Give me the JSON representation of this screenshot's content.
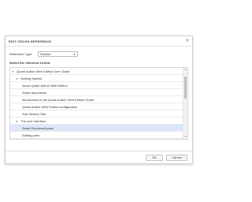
{
  "dialog": {
    "title": "EDIT CROSS REFERENCE",
    "close_icon": "×",
    "reference_type_label": "Reference Type:",
    "reference_type_value": "Section",
    "select_label": "Select the reference to link:",
    "ok_label": "OK",
    "cancel_label": "Cancel"
  },
  "tree": {
    "items": [
      {
        "label": "Quark Author Web Edition User Guide",
        "expander": "▼"
      },
      {
        "label": "Getting Started",
        "expander": "▼"
      },
      {
        "label": "About Quark Author Web Edition"
      },
      {
        "label": "Smart documents"
      },
      {
        "label": "Introduction to the Quark Author Web Edition Guide"
      },
      {
        "label": "Quark Author Web Edition configuration"
      },
      {
        "label": "Sub-Section Title"
      },
      {
        "label": "The user interface",
        "expander": "▼"
      },
      {
        "label": "Smart Document pane"
      },
      {
        "label": "Editing pane"
      }
    ],
    "scroll_up_icon": "▲",
    "scroll_down_icon": "▼"
  }
}
